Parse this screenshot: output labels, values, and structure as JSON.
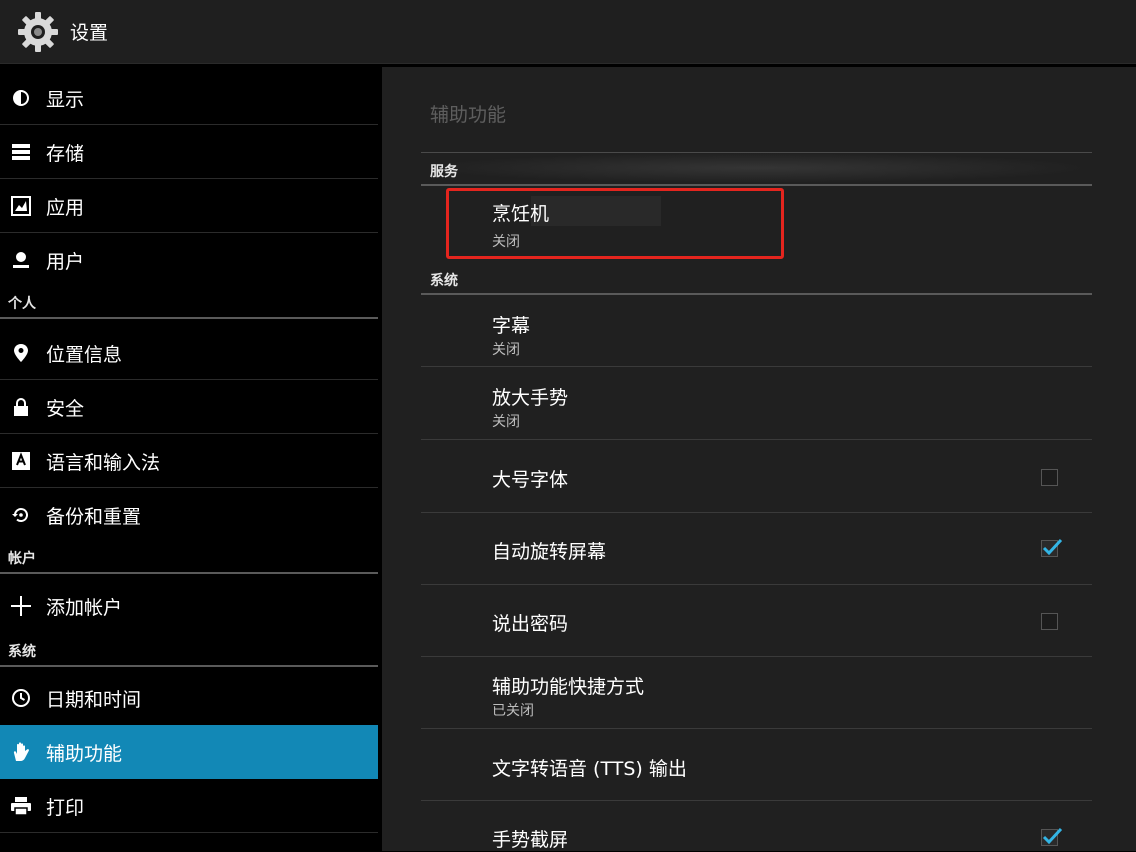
{
  "app": {
    "title": "设置",
    "icon": "gear-icon"
  },
  "sidebar": {
    "items_top": [
      {
        "label": "显示",
        "icon": "brightness-icon"
      },
      {
        "label": "存储",
        "icon": "storage-icon"
      },
      {
        "label": "应用",
        "icon": "apps-icon"
      },
      {
        "label": "用户",
        "icon": "user-icon"
      }
    ],
    "section_personal": "个人",
    "items_personal": [
      {
        "label": "位置信息",
        "icon": "location-icon"
      },
      {
        "label": "安全",
        "icon": "lock-icon"
      },
      {
        "label": "语言和输入法",
        "icon": "keyboard-language-icon"
      },
      {
        "label": "备份和重置",
        "icon": "backup-restore-icon"
      }
    ],
    "section_accounts": "帐户",
    "items_accounts": [
      {
        "label": "添加帐户",
        "icon": "plus-icon"
      }
    ],
    "section_system": "系统",
    "items_system": [
      {
        "label": "日期和时间",
        "icon": "clock-icon"
      },
      {
        "label": "辅助功能",
        "icon": "hand-icon",
        "selected": true
      },
      {
        "label": "打印",
        "icon": "printer-icon"
      }
    ],
    "selected_color": "#1288b6"
  },
  "content": {
    "title": "辅助功能",
    "section_services": "服务",
    "services": [
      {
        "title": "烹饪机",
        "summary": "关闭"
      }
    ],
    "section_system": "系统",
    "settings": [
      {
        "title": "字幕",
        "summary": "关闭"
      },
      {
        "title": "放大手势",
        "summary": "关闭"
      },
      {
        "title": "大号字体",
        "checked": false
      },
      {
        "title": "自动旋转屏幕",
        "checked": true
      },
      {
        "title": "说出密码",
        "checked": false
      },
      {
        "title": "辅助功能快捷方式",
        "summary": "已关闭"
      },
      {
        "title": "文字转语音 (TTS) 输出"
      },
      {
        "title": "手势截屏",
        "checked": true
      }
    ]
  },
  "colors": {
    "highlight": "#e4251e",
    "check_accent": "#33b5e5"
  }
}
